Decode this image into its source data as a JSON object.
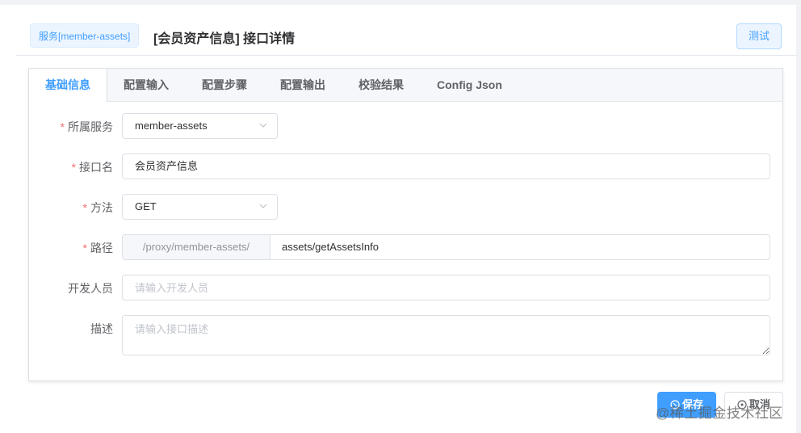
{
  "header": {
    "service_tag": "服务[member-assets]",
    "title": "[会员资产信息] 接口详情",
    "test_button": "测试"
  },
  "tabs": [
    {
      "label": "基础信息",
      "active": true
    },
    {
      "label": "配置输入",
      "active": false
    },
    {
      "label": "配置步骤",
      "active": false
    },
    {
      "label": "配置输出",
      "active": false
    },
    {
      "label": "校验结果",
      "active": false
    },
    {
      "label": "Config Json",
      "active": false
    }
  ],
  "form": {
    "service": {
      "label": "所属服务",
      "required": "*",
      "value": "member-assets"
    },
    "name": {
      "label": "接口名",
      "required": "*",
      "value": "会员资产信息"
    },
    "method": {
      "label": "方法",
      "required": "*",
      "value": "GET"
    },
    "path": {
      "label": "路径",
      "required": "*",
      "prefix": "/proxy/member-assets/",
      "value": "assets/getAssetsInfo"
    },
    "developer": {
      "label": "开发人员",
      "placeholder": "请输入开发人员"
    },
    "description": {
      "label": "描述",
      "placeholder": "请输入接口描述"
    }
  },
  "footer": {
    "save_button": "保存",
    "cancel_button": "取消"
  },
  "watermark": "@稀土掘金技术社区",
  "colors": {
    "primary": "#409eff",
    "required": "#f56c6c",
    "border": "#dcdfe6"
  },
  "icons": {
    "select_arrow": "chevron-down-icon",
    "save": "save-icon",
    "cancel": "close-circle-icon"
  }
}
